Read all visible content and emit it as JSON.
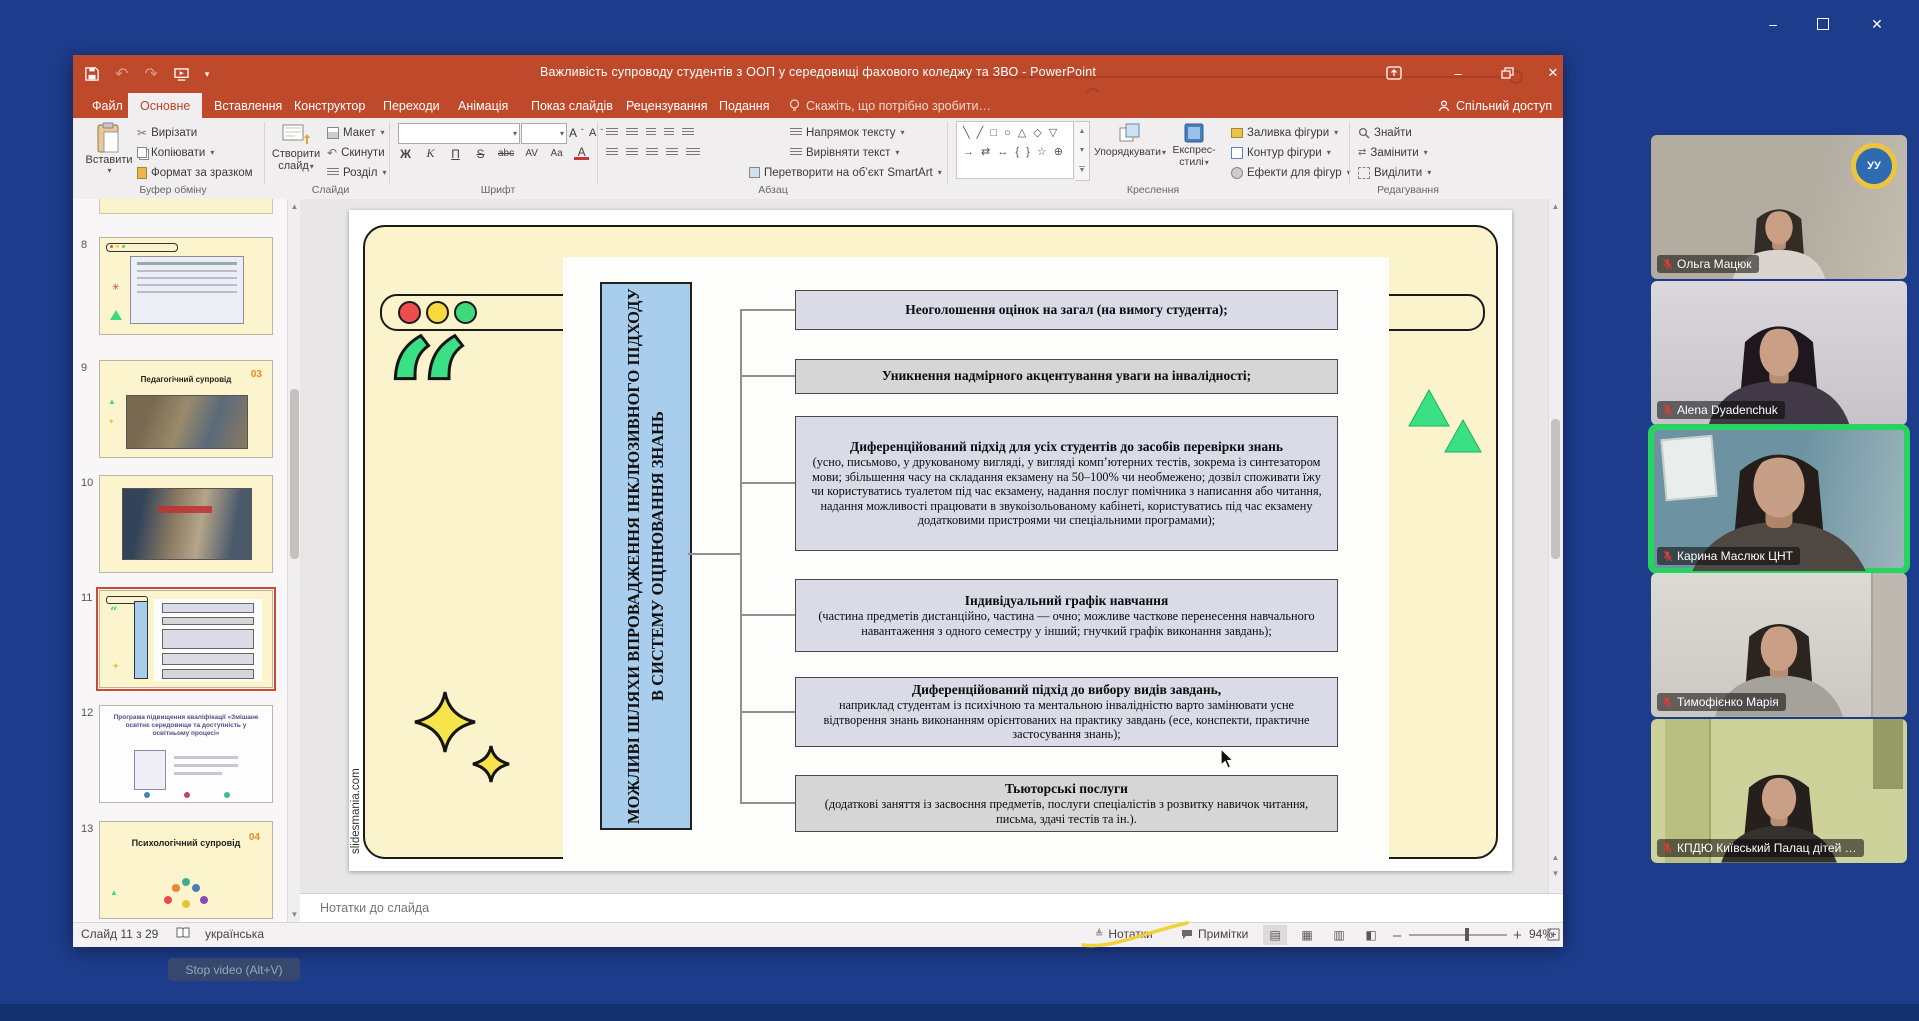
{
  "colors": {
    "accent_red": "#b7472a",
    "active_speaker_green": "#27d45f",
    "slide_yellow": "#fbf3cb",
    "box_blue": "#a9cdec",
    "quote_green": "#3ce084",
    "desktop_blue": "#1d3c8c"
  },
  "icons": {
    "dropdown": "▾",
    "up": "▲",
    "down": "▼",
    "collapse": "⌃",
    "undo": "↶",
    "redo": "↷",
    "minimize": "–",
    "close": "✕",
    "scissors": "✂",
    "sparkle": "✦",
    "shapes_row1": "╲ ╱ □ ○ △ ◇ ▽",
    "shapes_row2": "→ ⇄ ↔ { } ☆ ⊕",
    "bulb": "☀"
  },
  "powerpoint": {
    "title_bar": {
      "title": "Важливість супроводу студентів з ООП у середовищі фахового коледжу та ЗВО - PowerPoint"
    },
    "tabs": [
      "Файл",
      "Основне",
      "Вставлення",
      "Конструктор",
      "Переходи",
      "Анімація",
      "Показ слайдів",
      "Рецензування",
      "Подання"
    ],
    "tell_me": "Скажіть, що потрібно зробити…",
    "share": "Спільний доступ",
    "ribbon": {
      "paste": "Вставити",
      "cut": "Вирізати",
      "copy": "Копіювати",
      "format_painter": "Формат за зразком",
      "new_slide_1": "Створити",
      "new_slide_2": "слайд",
      "layout": "Макет",
      "reset": "Скинути",
      "section": "Розділ",
      "font_buttons": [
        "Ж",
        "К",
        "П",
        "S",
        "abc",
        "AV",
        "Aa",
        "А"
      ],
      "text_direction": "Напрямок тексту",
      "align_text": "Вирівняти текст",
      "smartart": "Перетворити на об’єкт SmartArt",
      "arrange": "Упорядкувати",
      "quick_styles_1": "Експрес-",
      "quick_styles_2": "стилі",
      "shape_fill": "Заливка фігури",
      "shape_outline": "Контур фігури",
      "shape_effects": "Ефекти для фігур",
      "find": "Знайти",
      "replace": "Замінити",
      "select": "Виділити",
      "groups": [
        "Буфер обміну",
        "Слайди",
        "Шрифт",
        "Абзац",
        "Креслення",
        "Редагування"
      ]
    },
    "thumbnails": [
      {
        "num": "8"
      },
      {
        "num": "9",
        "title": "Педагогічний супровід",
        "badge": "03"
      },
      {
        "num": "10"
      },
      {
        "num": "11"
      },
      {
        "num": "12",
        "title": "Програма підвищення кваліфікації «Змішане освітнє середовище та доступність у освітньому процесі»"
      },
      {
        "num": "13",
        "title": "Психологічний супровід",
        "badge": "04"
      }
    ],
    "notes_pane": {
      "placeholder": "Нотатки до слайда"
    },
    "status_bar": {
      "slide_indicator": "Слайд 11 з 29",
      "language": "українська",
      "notes": "Нотатки",
      "comments": "Примітки",
      "zoom_level": "94%"
    }
  },
  "slide": {
    "vertical_title": "МОЖЛИВІ ШЛЯХИ ВПРОВАДЖЕННЯ ІНКЛЮЗИВНОГО ПІДХОДУ В СИСТЕМУ ОЦІНЮВАННЯ ЗНАНЬ",
    "watermark": "slidesmania.com",
    "quote_glyph": "“",
    "boxes": [
      {
        "head": "Неоголошення оцінок на загал (на вимогу студента);",
        "body": ""
      },
      {
        "head": "Уникнення надмірного акцентування уваги на інвалідності;",
        "body": ""
      },
      {
        "head": "Диференційований підхід для усіх студентів до засобів перевірки знань",
        "body": "(усно, письмово, у друкованому вигляді, у вигляді комп’ютерних тестів, зокрема із синтезатором мови; збільшення часу на складання екзамену на 50–100% чи необмежено; дозвіл споживати їжу чи користуватись туалетом під час екзамену, надання послуг помічника з написання або читання, надання можливості працювати в звукоізольованому кабінеті, користуватись під час екзамену додатковими пристроями чи спеціальними програмами);"
      },
      {
        "head": "Індивідуальний графік навчання",
        "body": "(частина предметів дистанційно, частина — очно; можливе часткове перенесення навчального навантаження з одного семестру у інший; гнучкий графік виконання завдань);"
      },
      {
        "head": "Диференційований підхід до вибору видів завдань,",
        "body": "наприклад студентам із психічною та ментальною інвалідністю варто замінювати усне відтворення знань виконанням орієнтованих на практику завдань (есе, конспекти, практичне застосування знань);"
      },
      {
        "head": "Тьюторські послуги",
        "body": "(додаткові заняття із засвоєння предметів, послуги спеціалістів з розвитку навичок читання, письма, здачі тестів та ін.)."
      }
    ]
  },
  "zoom_app": {
    "stop_video_tooltip": "Stop video (Alt+V)",
    "participants": [
      {
        "name": "Ольга Мацюк",
        "muted": true
      },
      {
        "name": "Alena Dyadenchuk",
        "muted": true
      },
      {
        "name": "Карина Маслюк ЦНТ",
        "muted": true,
        "active": true
      },
      {
        "name": "Тимофієнко Марія",
        "muted": true
      },
      {
        "name": "КПДЮ Київський Палац дітей …",
        "muted": true
      }
    ]
  }
}
